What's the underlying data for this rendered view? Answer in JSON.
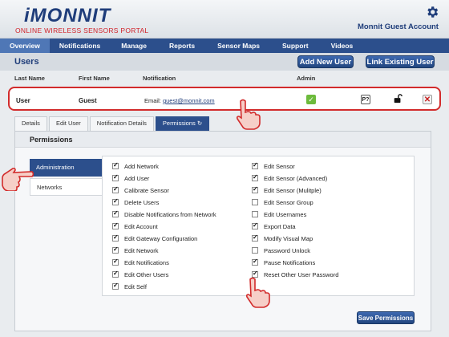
{
  "header": {
    "logo": "iMONNIT",
    "portal": "ONLINE WIRELESS SENSORS PORTAL",
    "account": "Monnit Guest Account"
  },
  "nav": [
    "Overview",
    "Notifications",
    "Manage",
    "Reports",
    "Sensor Maps",
    "Support",
    "Videos"
  ],
  "users_section": {
    "title": "Users",
    "add_new_user": "Add New User",
    "link_existing_user": "Link Existing User"
  },
  "columns": {
    "last_name": "Last Name",
    "first_name": "First Name",
    "notification": "Notification",
    "admin": "Admin"
  },
  "user": {
    "last_name": "User",
    "first_name": "Guest",
    "email_label": "Email:",
    "email": "guest@monnit.com"
  },
  "tabs": [
    "Details",
    "Edit User",
    "Notification Details",
    "Permissions ↻"
  ],
  "panel": {
    "title": "Permissions",
    "sidebar": [
      "Administration",
      "Networks"
    ],
    "save": "Save Permissions"
  },
  "permissions_left": [
    {
      "label": "Add Network",
      "checked": true
    },
    {
      "label": "Add User",
      "checked": true
    },
    {
      "label": "Calibrate Sensor",
      "checked": true
    },
    {
      "label": "Delete Users",
      "checked": true
    },
    {
      "label": "Disable Notifications from Network",
      "checked": true
    },
    {
      "label": "Edit Account",
      "checked": true
    },
    {
      "label": "Edit Gateway Configuration",
      "checked": true
    },
    {
      "label": "Edit Network",
      "checked": true
    },
    {
      "label": "Edit Notifications",
      "checked": true
    },
    {
      "label": "Edit Other Users",
      "checked": true
    },
    {
      "label": "Edit Self",
      "checked": true
    }
  ],
  "permissions_right": [
    {
      "label": "Edit Sensor",
      "checked": true
    },
    {
      "label": "Edit Sensor (Advanced)",
      "checked": true
    },
    {
      "label": "Edit Sensor (Mulitple)",
      "checked": true
    },
    {
      "label": "Edit Sensor Group",
      "checked": false
    },
    {
      "label": "Edit Usernames",
      "checked": false
    },
    {
      "label": "Export Data",
      "checked": true
    },
    {
      "label": "Modify Visual Map",
      "checked": true
    },
    {
      "label": "Password Unlock",
      "checked": false
    },
    {
      "label": "Pause Notifications",
      "checked": true
    },
    {
      "label": "Reset Other User Password",
      "checked": true
    }
  ],
  "colors": {
    "brand_blue": "#2c4f8c",
    "brand_red": "#d1232a",
    "highlight_red": "#d22b2b",
    "pointer_fill": "#f6cfc8"
  }
}
